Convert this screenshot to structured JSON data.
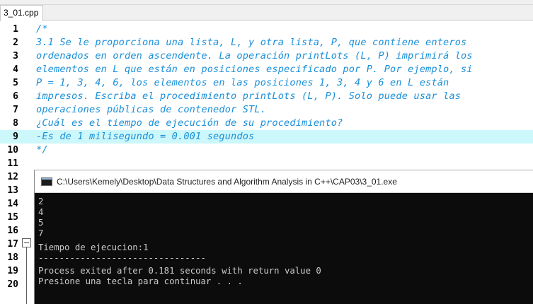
{
  "tab": {
    "label": "3_01.cpp"
  },
  "editor": {
    "lines": [
      {
        "num": "1",
        "text": "/*"
      },
      {
        "num": "2",
        "text": "3.1 Se le proporciona una lista, L, y otra lista, P, que contiene enteros"
      },
      {
        "num": "3",
        "text": "ordenados en orden ascendente. La operación printLots (L, P) imprimirá los"
      },
      {
        "num": "4",
        "text": "elementos en L que están en posiciones especificado por P. Por ejemplo, si"
      },
      {
        "num": "5",
        "text": "P = 1, 3, 4, 6, los elementos en las posiciones 1, 3, 4 y 6 en L están"
      },
      {
        "num": "6",
        "text": "impresos. Escriba el procedimiento printLots (L, P). Solo puede usar las"
      },
      {
        "num": "7",
        "text": "operaciones públicas de contenedor STL."
      },
      {
        "num": "8",
        "text": "¿Cuál es el tiempo de ejecución de su procedimiento?"
      },
      {
        "num": "9",
        "text": "-Es de 1 milisegundo = 0.001 segundos"
      },
      {
        "num": "10",
        "text": "*/"
      },
      {
        "num": "11",
        "text": ""
      },
      {
        "num": "12",
        "text": ""
      },
      {
        "num": "13",
        "text": ""
      },
      {
        "num": "14",
        "text": ""
      },
      {
        "num": "15",
        "text": ""
      },
      {
        "num": "16",
        "text": ""
      },
      {
        "num": "17",
        "text": ""
      },
      {
        "num": "18",
        "text": ""
      },
      {
        "num": "19",
        "text": ""
      },
      {
        "num": "20",
        "text": ""
      }
    ],
    "highlighted_line": "9"
  },
  "console": {
    "title": "C:\\Users\\Kemely\\Desktop\\Data Structures and Algorithm Analysis in C++\\CAP03\\3_01.exe",
    "lines": [
      "2",
      "4",
      "5",
      "7",
      "Tiempo de ejecucion:1",
      "--------------------------------",
      "Process exited after 0.181 seconds with return value 0",
      "Presione una tecla para continuar . . ."
    ]
  }
}
